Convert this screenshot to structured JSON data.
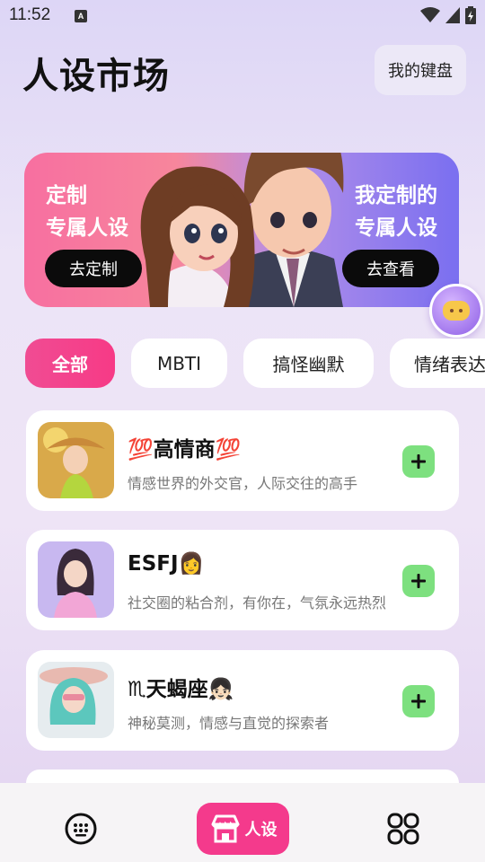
{
  "status_bar": {
    "time": "11:52",
    "app_icon_letter": "A"
  },
  "header": {
    "title": "人设市场",
    "my_keyboard_label": "我的键盘"
  },
  "banner": {
    "left_line1": "定制",
    "left_line2": "专属人设",
    "left_button": "去定制",
    "right_line1": "我定制的",
    "right_line2": "专属人设",
    "right_button": "去查看"
  },
  "chips": [
    {
      "label": "全部",
      "active": true
    },
    {
      "label": "MBTI",
      "active": false
    },
    {
      "label": "搞怪幽默",
      "active": false
    },
    {
      "label": "情绪表达",
      "active": false
    }
  ],
  "personas": [
    {
      "title": "💯高情商💯",
      "desc": "情感世界的外交官，人际交往的高手",
      "avatar": "woman-in-hat-portrait"
    },
    {
      "title": "ESFJ👩",
      "desc": "社交圈的粘合剂，有你在，气氛永远热烈",
      "avatar": "woman-pink-outfit-portrait"
    },
    {
      "title": "♏天蝎座👧🏻",
      "desc": "神秘莫测，情感与直觉的探索者",
      "avatar": "woman-teal-hair-hat-portrait"
    }
  ],
  "bottom_nav": {
    "persona_label": "人设"
  },
  "colors": {
    "accent_pink": "#f43a8c",
    "add_green": "#7de07f"
  }
}
